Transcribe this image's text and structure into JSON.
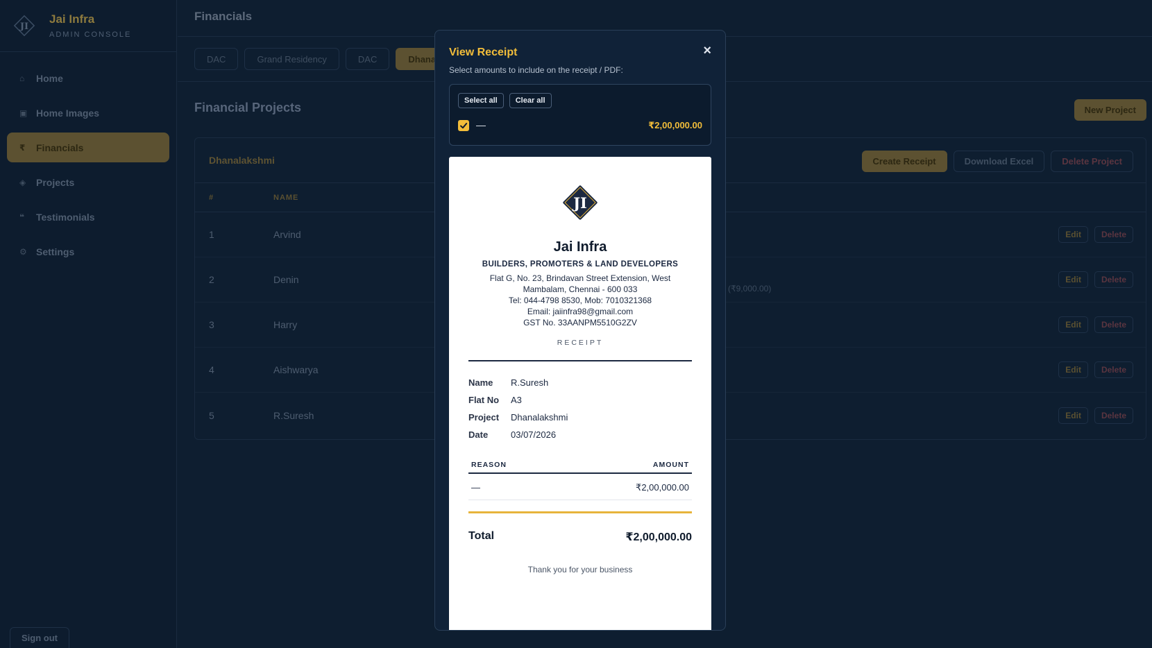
{
  "brand": {
    "name": "Jai Infra",
    "subtitle": "ADMIN CONSOLE",
    "logo_text": "JI"
  },
  "sidebar": {
    "items": [
      {
        "label": "Home",
        "icon": "⌂"
      },
      {
        "label": "Home Images",
        "icon": "▣"
      },
      {
        "label": "Financials",
        "icon": "₹"
      },
      {
        "label": "Projects",
        "icon": "◈"
      },
      {
        "label": "Testimonials",
        "icon": "❝"
      },
      {
        "label": "Settings",
        "icon": "⚙"
      }
    ],
    "signout": "Sign out"
  },
  "header": {
    "title": "Financials"
  },
  "project_tabs": [
    {
      "label": "DAC"
    },
    {
      "label": "Grand Residency"
    },
    {
      "label": "DAC"
    },
    {
      "label": "Dhanala"
    }
  ],
  "section": {
    "title": "Financial Projects",
    "new_project": "New Project"
  },
  "card": {
    "title": "Dhanalakshmi",
    "actions": {
      "create_receipt": "Create Receipt",
      "download_excel": "Download Excel",
      "delete_project": "Delete Project"
    },
    "columns": {
      "num": "#",
      "name": "NAME"
    },
    "rows": [
      {
        "num": "1",
        "name": "Arvind",
        "extra": ""
      },
      {
        "num": "2",
        "name": "Denin",
        "extra": "(₹9,000.00)"
      },
      {
        "num": "3",
        "name": "Harry",
        "extra": ""
      },
      {
        "num": "4",
        "name": "Aishwarya",
        "extra": ""
      },
      {
        "num": "5",
        "name": "R.Suresh",
        "extra": ""
      }
    ],
    "edit_label": "Edit",
    "delete_label": "Delete"
  },
  "modal": {
    "title": "View Receipt",
    "close": "×",
    "subtitle": "Select amounts to include on the receipt / PDF:",
    "select_all": "Select all",
    "clear_all": "Clear all",
    "item": {
      "label": "—",
      "amount": "₹2,00,000.00",
      "checked": true
    }
  },
  "receipt": {
    "logo_text": "JI",
    "company": "Jai Infra",
    "tagline": "BUILDERS, PROMOTERS & LAND DEVELOPERS",
    "address_1": "Flat G, No. 23, Brindavan Street Extension, West",
    "address_2": "Mambalam, Chennai - 600 033",
    "phone": "Tel: 044-4798 8530, Mob: 7010321368",
    "email": "Email: jaiinfra98@gmail.com",
    "gst": "GST No. 33AANPM5510G2ZV",
    "doc_label": "RECEIPT",
    "fields": [
      {
        "key": "Name",
        "value": "R.Suresh"
      },
      {
        "key": "Flat No",
        "value": "A3"
      },
      {
        "key": "Project",
        "value": "Dhanalakshmi"
      },
      {
        "key": "Date",
        "value": "03/07/2026"
      }
    ],
    "table": {
      "reason_header": "REASON",
      "amount_header": "AMOUNT",
      "reason": "—",
      "amount": "₹2,00,000.00"
    },
    "total_label": "Total",
    "total_value": "₹2,00,000.00",
    "thanks": "Thank you for your business"
  },
  "colors": {
    "accent": "#f2bd3a",
    "background": "#0e1e30",
    "navy": "#1b2840"
  }
}
